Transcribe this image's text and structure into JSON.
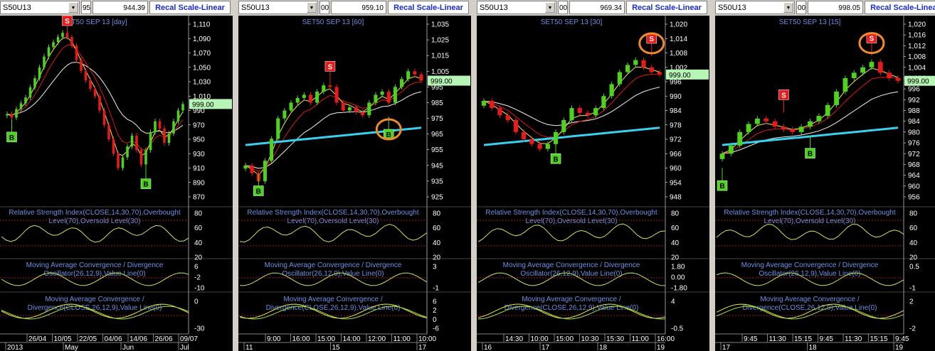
{
  "colors": {
    "price_label_bg": "#b7f5b7",
    "signal_buy": "#4fd21e",
    "signal_sell": "#e81a1a",
    "highlight_ring": "#f28a2a",
    "ma_cyan": "#39d0f0",
    "title_blue": "#6f8fe0"
  },
  "panels": [
    {
      "symbol": "S50U13",
      "small_box": "95",
      "value": "944.39",
      "recal_label": "Recal Scale-Linear",
      "chart_title": "SET50 SEP 13  [day]",
      "last_price": "999.00",
      "y_ticks": [
        "1,110",
        "1,090",
        "1,070",
        "1,050",
        "1,030",
        "1,010",
        "990",
        "970",
        "950",
        "930",
        "910",
        "890",
        "870"
      ],
      "y_min": 870,
      "y_max": 1110,
      "last_value": 999,
      "closes": [
        985,
        980,
        992,
        1000,
        1008,
        1022,
        1035,
        1050,
        1065,
        1078,
        1085,
        1092,
        1098,
        1092,
        1080,
        1060,
        1045,
        1032,
        1020,
        1010,
        990,
        970,
        950,
        930,
        910,
        925,
        940,
        955,
        935,
        915,
        935,
        960,
        975,
        965,
        945,
        958,
        975,
        990,
        999
      ],
      "buy_markers": [
        {
          "label": "B",
          "i": 1,
          "v": 960
        },
        {
          "label": "B",
          "i": 30,
          "v": 895
        }
      ],
      "sell_markers": [
        {
          "label": "S",
          "i": 13,
          "v": 1108
        }
      ],
      "rsi_title": [
        "Relative Strength Index(CLOSE,14,30,70),Overbought",
        "Level(70),Oversold Level(30)"
      ],
      "rsi_ticks": [
        "80",
        "60",
        "40",
        "20"
      ],
      "macd1_title": [
        "Moving Average Convergence / Divergence",
        "Oscillator(26,12,9),Value Line(0)"
      ],
      "macd1_ticks": [
        "6",
        "-2",
        "-10"
      ],
      "macd2_title": [
        "Moving Average Convergence /",
        "Divergence(CLOSE,26,12,9),Value Line(0)"
      ],
      "macd2_ticks": [
        "0",
        "-30"
      ],
      "x_labels": [
        "26/04",
        "10/05",
        "22/05",
        "04/06",
        "14/06",
        "26/06",
        "09/07"
      ],
      "x_labels_bottom": [
        "2013",
        "May",
        "Jun",
        "Jul"
      ]
    },
    {
      "symbol": "S50U13",
      "small_box": "00",
      "value": "959.10",
      "recal_label": "Recal Scale-Linear",
      "chart_title": "SET50 SEP 13  [60]",
      "last_price": "999.00",
      "y_ticks": [
        "1,035",
        "1,025",
        "1,015",
        "1,005",
        "995",
        "985",
        "975",
        "965",
        "955",
        "945",
        "935",
        "925"
      ],
      "y_min": 925,
      "y_max": 1035,
      "last_value": 999,
      "closes": [
        945,
        940,
        935,
        948,
        962,
        975,
        980,
        985,
        988,
        990,
        985,
        992,
        996,
        995,
        985,
        980,
        982,
        979,
        977,
        985,
        990,
        992,
        985,
        995,
        1000,
        1005,
        1003,
        999
      ],
      "buy_markers": [
        {
          "label": "B",
          "i": 2,
          "v": 932
        },
        {
          "label": "B",
          "i": 22,
          "v": 968
        }
      ],
      "sell_markers": [
        {
          "label": "S",
          "i": 13,
          "v": 1005
        }
      ],
      "rings": [
        {
          "i": 22,
          "v": 968
        }
      ],
      "rsi_title": [
        "Relative Strength Index(CLOSE,14,30,70),Overbought",
        "Level(70),Oversold Level(30)"
      ],
      "rsi_ticks": [
        "80",
        "60",
        "40",
        "20"
      ],
      "macd1_title": [
        "Moving Average Convergence / Divergence",
        "Oscillator(26,12,9),Value Line(0)"
      ],
      "macd1_ticks": [
        "3",
        "-1"
      ],
      "macd2_title": [
        "Moving Average Convergence /",
        "Divergence(CLOSE,26,12,9),Value Line(0)"
      ],
      "macd2_ticks": [
        "6",
        "2",
        "0",
        "-6"
      ],
      "x_labels": [
        "9:00",
        "16:00",
        "15:00",
        "14:00",
        "12:00",
        "11:00",
        "10:00"
      ],
      "x_labels_bottom": [
        "11",
        "15",
        "17"
      ]
    },
    {
      "symbol": "S50U13",
      "small_box": "00",
      "value": "969.34",
      "recal_label": "Recal Scale-Linear",
      "chart_title": "SET50 SEP 13  [30]",
      "last_price": "999.00",
      "y_ticks": [
        "1,020",
        "1,014",
        "1,008",
        "1,002",
        "996",
        "990",
        "984",
        "978",
        "972",
        "966",
        "960",
        "954",
        "948"
      ],
      "y_min": 948,
      "y_max": 1020,
      "last_value": 999,
      "closes": [
        988,
        985,
        982,
        980,
        975,
        972,
        970,
        968,
        970,
        975,
        980,
        985,
        983,
        982,
        985,
        990,
        995,
        1000,
        1003,
        1005,
        1002,
        1000,
        999
      ],
      "buy_markers": [
        {
          "label": "B",
          "i": 9,
          "v": 966
        }
      ],
      "sell_markers": [
        {
          "label": "S",
          "i": 21,
          "v": 1012
        }
      ],
      "rings": [
        {
          "i": 21,
          "v": 1012
        }
      ],
      "rsi_title": [
        "Relative Strength Index(CLOSE,14,30,70),Overbought",
        "Level(70),Oversold Level(30)"
      ],
      "rsi_ticks": [
        "80",
        "60",
        "40",
        "20"
      ],
      "macd1_title": [
        "Moving Average Convergence / Divergence",
        "Oscillator(26,12,9),Value Line(0)"
      ],
      "macd1_ticks": [
        "1.80",
        "0.00",
        "-1.80"
      ],
      "macd2_title": [
        "Moving Average Convergence /",
        "Divergence(CLOSE,26,12,9),Value Line(0)"
      ],
      "macd2_ticks": [
        "4",
        "-0.5"
      ],
      "x_labels": [
        "14:30",
        "10:00",
        "15:00",
        "10:30",
        "15:30",
        "11:00",
        "16:00"
      ],
      "x_labels_bottom": [
        "16",
        "17",
        "18",
        "19"
      ]
    },
    {
      "symbol": "S50U13",
      "small_box": "00",
      "value": "998.05",
      "recal_label": "Recal Scale-Linear",
      "chart_title": "SET50 SEP 13  [15]",
      "last_price": "999.00",
      "y_ticks": [
        "1,020",
        "1,016",
        "1,012",
        "1,008",
        "1,004",
        "1,000",
        "996",
        "992",
        "988",
        "984",
        "980",
        "976",
        "972",
        "968",
        "964",
        "960",
        "956"
      ],
      "y_min": 956,
      "y_max": 1020,
      "last_value": 999,
      "closes": [
        972,
        975,
        980,
        983,
        985,
        984,
        982,
        981,
        980,
        982,
        984,
        986,
        990,
        995,
        1000,
        1002,
        1004,
        1006,
        1002,
        1000,
        999
      ],
      "buy_markers": [
        {
          "label": "B",
          "i": 0,
          "v": 962
        },
        {
          "label": "B",
          "i": 10,
          "v": 974
        }
      ],
      "sell_markers": [
        {
          "label": "S",
          "i": 7,
          "v": 992
        },
        {
          "label": "S",
          "i": 17,
          "v": 1013
        }
      ],
      "rings": [
        {
          "i": 17,
          "v": 1013
        }
      ],
      "rsi_title": [
        "Relative Strength Index(CLOSE,14,30,70),Overbought",
        "Level(70),Oversold Level(30)"
      ],
      "rsi_ticks": [
        "80",
        "60",
        "40",
        "20"
      ],
      "macd1_title": [
        "Moving Average Convergence / Divergence",
        "Oscillator(26,12,9),Value Line(0)"
      ],
      "macd1_ticks": [
        "0.5",
        "-1"
      ],
      "macd2_title": [
        "Moving Average Convergence /",
        "Divergence(CLOSE,26,12,9),Value Line(0)"
      ],
      "macd2_ticks": [
        "2",
        "-2"
      ],
      "x_labels": [
        "9:45",
        "11:30",
        "15:15",
        "9:45",
        "11:30",
        "15:15",
        "9:45"
      ],
      "x_labels_bottom": [
        "17",
        "18",
        "19"
      ]
    }
  ]
}
